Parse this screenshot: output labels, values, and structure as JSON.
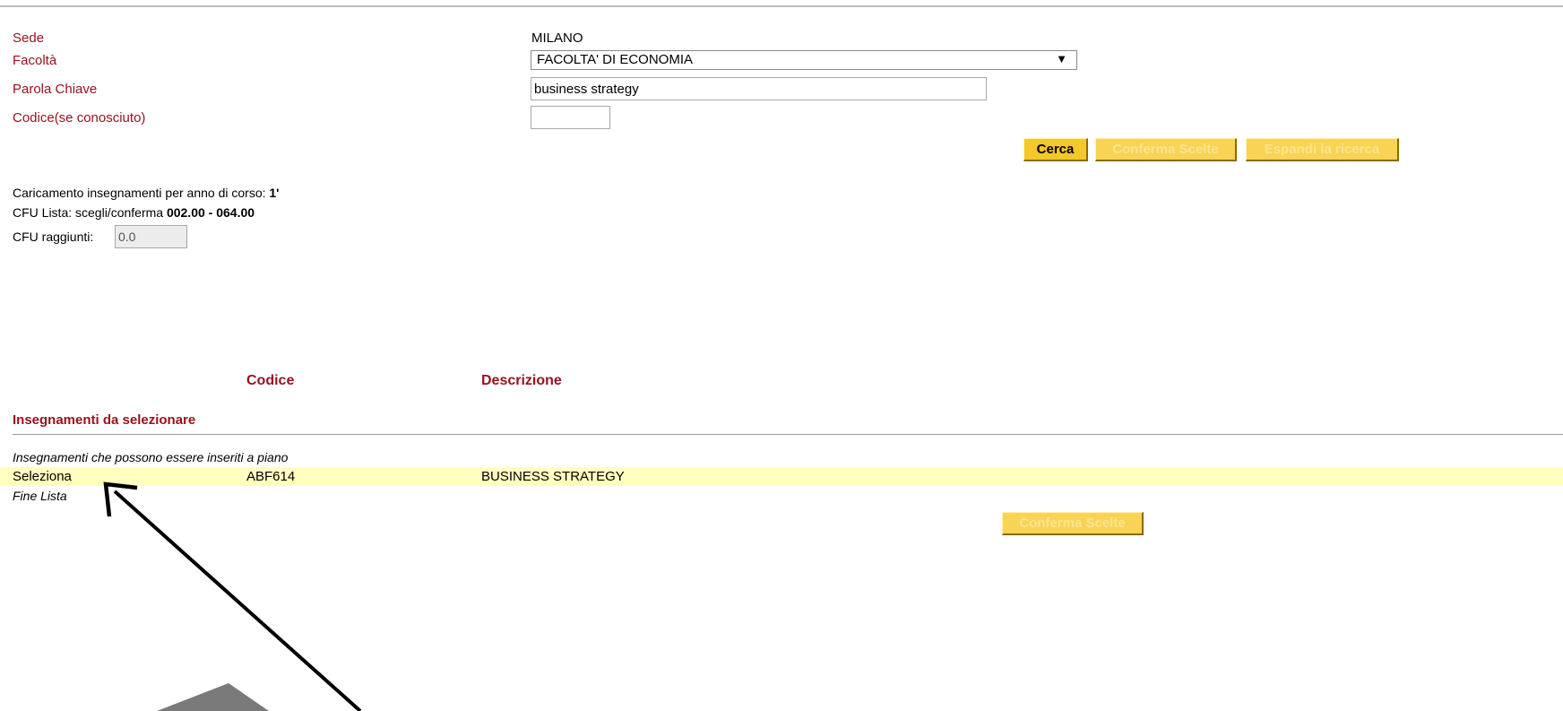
{
  "form": {
    "sede_label": "Sede",
    "sede_value": "MILANO",
    "facolta_label": "Facoltà",
    "facolta_value": "FACOLTA' DI ECONOMIA",
    "parola_label": "Parola Chiave",
    "parola_value": "business strategy",
    "codice_label": "Codice(se conosciuto)",
    "codice_value": ""
  },
  "buttons": {
    "cerca": "Cerca",
    "conferma": "Conferma Scelte",
    "espandi": "Espandi la ricerca",
    "conferma_bottom": "Conferma Scelte"
  },
  "info": {
    "caricamento_text": "Caricamento insegnamenti per anno di corso: ",
    "caricamento_value": "1'",
    "cfu_lista_text": "CFU Lista: scegli/conferma ",
    "cfu_lista_value": "002.00 - 064.00",
    "cfu_raggiunti_label": "CFU raggiunti:",
    "cfu_raggiunti_value": "0.0"
  },
  "table": {
    "col_codice": "Codice",
    "col_descrizione": "Descrizione",
    "section_title": "Insegnamenti da selezionare",
    "group_label": "Insegnamenti che possono essere inseriti a piano",
    "rows": [
      {
        "action": "Seleziona",
        "codice": "ABF614",
        "descrizione": "BUSINESS STRATEGY"
      }
    ],
    "end_label": "Fine Lista"
  },
  "colors": {
    "label_red": "#990f1c",
    "button_yellow": "#f4c72a",
    "row_highlight": "#ffffc0"
  },
  "icons": {
    "dropdown": "triangle-down",
    "annotation": "arrow-pointer"
  }
}
